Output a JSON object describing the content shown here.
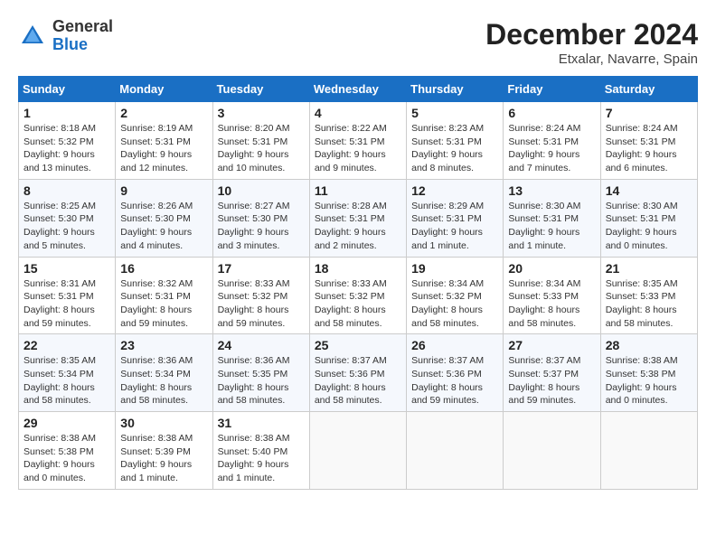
{
  "header": {
    "logo_general": "General",
    "logo_blue": "Blue",
    "month_title": "December 2024",
    "location": "Etxalar, Navarre, Spain"
  },
  "weekdays": [
    "Sunday",
    "Monday",
    "Tuesday",
    "Wednesday",
    "Thursday",
    "Friday",
    "Saturday"
  ],
  "weeks": [
    [
      {
        "day": "1",
        "sunrise": "8:18 AM",
        "sunset": "5:32 PM",
        "daylight": "9 hours and 13 minutes."
      },
      {
        "day": "2",
        "sunrise": "8:19 AM",
        "sunset": "5:31 PM",
        "daylight": "9 hours and 12 minutes."
      },
      {
        "day": "3",
        "sunrise": "8:20 AM",
        "sunset": "5:31 PM",
        "daylight": "9 hours and 10 minutes."
      },
      {
        "day": "4",
        "sunrise": "8:22 AM",
        "sunset": "5:31 PM",
        "daylight": "9 hours and 9 minutes."
      },
      {
        "day": "5",
        "sunrise": "8:23 AM",
        "sunset": "5:31 PM",
        "daylight": "9 hours and 8 minutes."
      },
      {
        "day": "6",
        "sunrise": "8:24 AM",
        "sunset": "5:31 PM",
        "daylight": "9 hours and 7 minutes."
      },
      {
        "day": "7",
        "sunrise": "8:24 AM",
        "sunset": "5:31 PM",
        "daylight": "9 hours and 6 minutes."
      }
    ],
    [
      {
        "day": "8",
        "sunrise": "8:25 AM",
        "sunset": "5:30 PM",
        "daylight": "9 hours and 5 minutes."
      },
      {
        "day": "9",
        "sunrise": "8:26 AM",
        "sunset": "5:30 PM",
        "daylight": "9 hours and 4 minutes."
      },
      {
        "day": "10",
        "sunrise": "8:27 AM",
        "sunset": "5:30 PM",
        "daylight": "9 hours and 3 minutes."
      },
      {
        "day": "11",
        "sunrise": "8:28 AM",
        "sunset": "5:31 PM",
        "daylight": "9 hours and 2 minutes."
      },
      {
        "day": "12",
        "sunrise": "8:29 AM",
        "sunset": "5:31 PM",
        "daylight": "9 hours and 1 minute."
      },
      {
        "day": "13",
        "sunrise": "8:30 AM",
        "sunset": "5:31 PM",
        "daylight": "9 hours and 1 minute."
      },
      {
        "day": "14",
        "sunrise": "8:30 AM",
        "sunset": "5:31 PM",
        "daylight": "9 hours and 0 minutes."
      }
    ],
    [
      {
        "day": "15",
        "sunrise": "8:31 AM",
        "sunset": "5:31 PM",
        "daylight": "8 hours and 59 minutes."
      },
      {
        "day": "16",
        "sunrise": "8:32 AM",
        "sunset": "5:31 PM",
        "daylight": "8 hours and 59 minutes."
      },
      {
        "day": "17",
        "sunrise": "8:33 AM",
        "sunset": "5:32 PM",
        "daylight": "8 hours and 59 minutes."
      },
      {
        "day": "18",
        "sunrise": "8:33 AM",
        "sunset": "5:32 PM",
        "daylight": "8 hours and 58 minutes."
      },
      {
        "day": "19",
        "sunrise": "8:34 AM",
        "sunset": "5:32 PM",
        "daylight": "8 hours and 58 minutes."
      },
      {
        "day": "20",
        "sunrise": "8:34 AM",
        "sunset": "5:33 PM",
        "daylight": "8 hours and 58 minutes."
      },
      {
        "day": "21",
        "sunrise": "8:35 AM",
        "sunset": "5:33 PM",
        "daylight": "8 hours and 58 minutes."
      }
    ],
    [
      {
        "day": "22",
        "sunrise": "8:35 AM",
        "sunset": "5:34 PM",
        "daylight": "8 hours and 58 minutes."
      },
      {
        "day": "23",
        "sunrise": "8:36 AM",
        "sunset": "5:34 PM",
        "daylight": "8 hours and 58 minutes."
      },
      {
        "day": "24",
        "sunrise": "8:36 AM",
        "sunset": "5:35 PM",
        "daylight": "8 hours and 58 minutes."
      },
      {
        "day": "25",
        "sunrise": "8:37 AM",
        "sunset": "5:36 PM",
        "daylight": "8 hours and 58 minutes."
      },
      {
        "day": "26",
        "sunrise": "8:37 AM",
        "sunset": "5:36 PM",
        "daylight": "8 hours and 59 minutes."
      },
      {
        "day": "27",
        "sunrise": "8:37 AM",
        "sunset": "5:37 PM",
        "daylight": "8 hours and 59 minutes."
      },
      {
        "day": "28",
        "sunrise": "8:38 AM",
        "sunset": "5:38 PM",
        "daylight": "9 hours and 0 minutes."
      }
    ],
    [
      {
        "day": "29",
        "sunrise": "8:38 AM",
        "sunset": "5:38 PM",
        "daylight": "9 hours and 0 minutes."
      },
      {
        "day": "30",
        "sunrise": "8:38 AM",
        "sunset": "5:39 PM",
        "daylight": "9 hours and 1 minute."
      },
      {
        "day": "31",
        "sunrise": "8:38 AM",
        "sunset": "5:40 PM",
        "daylight": "9 hours and 1 minute."
      },
      null,
      null,
      null,
      null
    ]
  ]
}
